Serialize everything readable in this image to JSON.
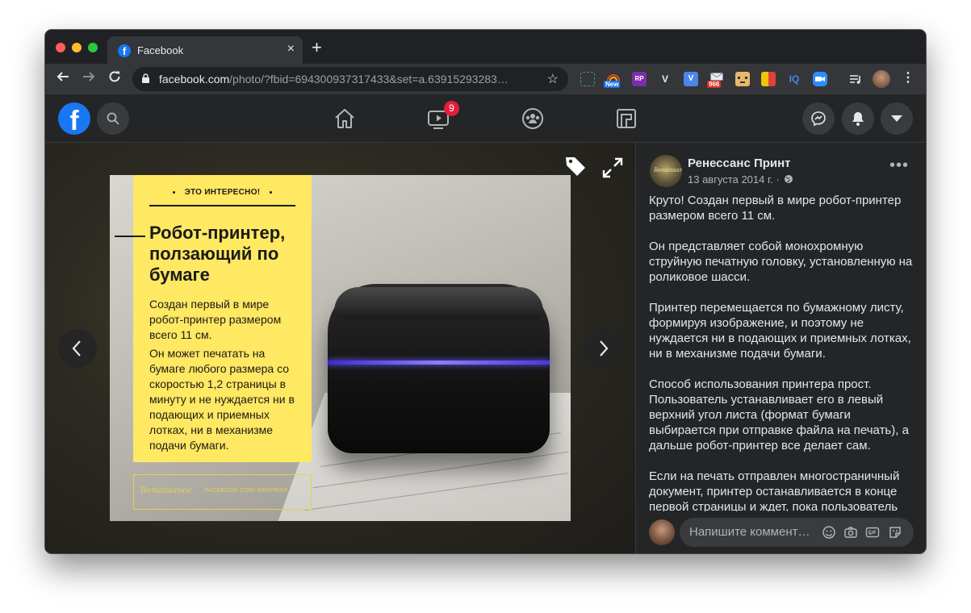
{
  "browser": {
    "tab_title": "Facebook",
    "tab_close": "×",
    "new_tab": "+",
    "url_host": "facebook.com",
    "url_path": "/photo/?fbid=694300937317433&set=a.63915293283…",
    "extensions": [
      {
        "name": "screenshot-ext",
        "badge": ""
      },
      {
        "name": "rainbow-ext",
        "badge": "New"
      },
      {
        "name": "rp-ext",
        "label": "RP"
      },
      {
        "name": "v-ext",
        "label": "V"
      },
      {
        "name": "v-blue-ext",
        "label": "V"
      },
      {
        "name": "mail-ext",
        "badge": "966"
      },
      {
        "name": "face-ext",
        "label": ""
      },
      {
        "name": "flag-ext",
        "label": ""
      },
      {
        "name": "iq-ext",
        "label": "IQ"
      },
      {
        "name": "zoom-ext",
        "label": ""
      }
    ]
  },
  "fb": {
    "watch_badge": "9",
    "colors": {
      "brand": "#1877f2",
      "badge": "#e41e3f",
      "bg": "#18191a",
      "surface": "#242526"
    }
  },
  "photo": {
    "kicker": "ЭТО ИНТЕРЕСНО!",
    "headline": "Робот-принтер, ползающий по бумаге",
    "body1": "Создан первый в мире робот-принтер размером всего 11 см.",
    "body2": "Он может печатать на бумаге любого размера со скоростью 1,2 страницы в минуту и не нуждается ни в подающих и приемных лотках, ни в механизме подачи бумаги.",
    "footer_sig": "Renaissance",
    "footer_sub": "FACEBOOK.COM/ RENPRINT"
  },
  "post": {
    "author": "Ренессанс Принт",
    "date": "13 августа 2014 г. ·",
    "more": "•••",
    "paragraphs": [
      "Круто! Создан первый в мире робот-принтер размером всего 11 см.",
      "Он представляет собой монохромную струйную печатную головку, установленную на роликовое шасси.",
      "Принтер перемещается по бумажному листу, формируя изображение, и поэтому не нуждается ни в подающих и приемных лотках, ни в механизме подачи бумаги.",
      "Способ использования принтера прост. Пользователь устанавливает его в левый верхний угол листа (формат бумаги выбирается при отправке файла на печать), а дальше робот-принтер все делает сам.",
      "Если на печать отправлен многостраничный документ, принтер останавливается в конце первой страницы и ждет, пока пользователь"
    ],
    "comment_placeholder": "Напишите коммент…"
  }
}
